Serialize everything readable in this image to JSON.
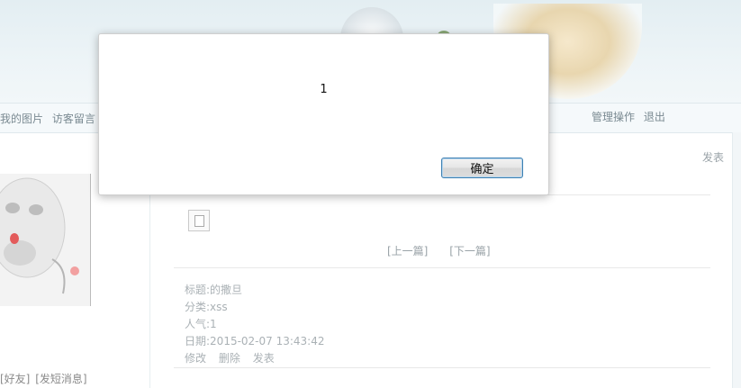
{
  "nav": {
    "left_items": [
      "我的图片",
      "访客留言"
    ],
    "right_items": [
      "管理操作",
      "退出"
    ]
  },
  "sidebar": {
    "links": [
      "[好友]",
      "[发短消息]"
    ]
  },
  "main": {
    "post_label": "发表",
    "pager": {
      "prev": "[上一篇]",
      "next": "[下一篇]"
    },
    "meta": {
      "title": "标题:的撒旦",
      "category": "分类:xss",
      "popularity": "人气:1",
      "date": "日期:2015-02-07 13:43:42",
      "actions": [
        "修改",
        "删除",
        "发表"
      ]
    }
  },
  "dialog": {
    "message": "1",
    "ok_label": "确定"
  }
}
